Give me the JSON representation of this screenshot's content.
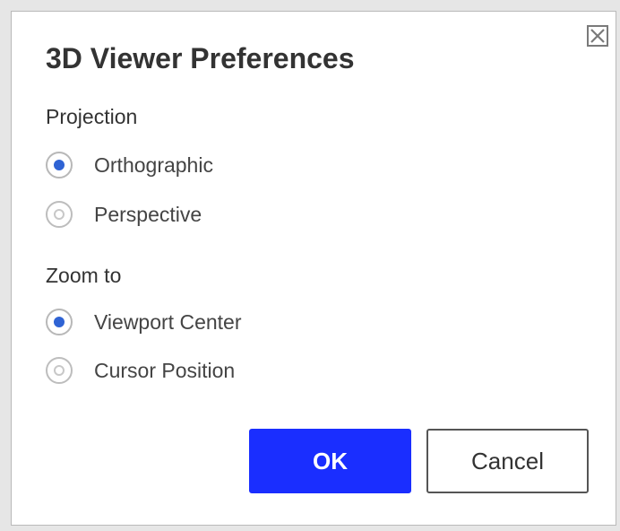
{
  "dialog": {
    "title": "3D Viewer Preferences",
    "close_icon": "close-icon",
    "projection": {
      "label": "Projection",
      "options": [
        {
          "label": "Orthographic",
          "checked": true
        },
        {
          "label": "Perspective",
          "checked": false
        }
      ]
    },
    "zoom": {
      "label": "Zoom to",
      "options": [
        {
          "label": "Viewport Center",
          "checked": true
        },
        {
          "label": "Cursor Position",
          "checked": false
        }
      ]
    },
    "buttons": {
      "ok_label": "OK",
      "cancel_label": "Cancel"
    }
  },
  "colors": {
    "ok_background": "#1a2eff",
    "radio_checked": "#2f63d4",
    "page_background": "#e6e6e6"
  }
}
